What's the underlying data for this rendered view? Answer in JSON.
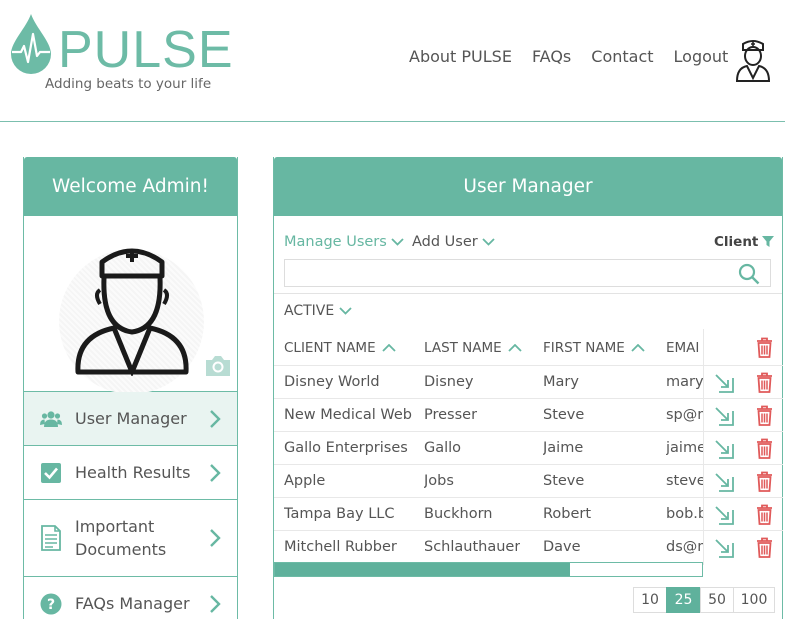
{
  "brand": {
    "name": "PULSE",
    "tagline": "Adding beats to your life",
    "accent": "#67b7a2"
  },
  "nav": [
    {
      "label": "About PULSE"
    },
    {
      "label": "FAQs"
    },
    {
      "label": "Contact"
    },
    {
      "label": "Logout"
    }
  ],
  "left": {
    "title": "Welcome Admin!",
    "menu": [
      {
        "label": "User Manager",
        "icon": "users-icon"
      },
      {
        "label": "Health Results",
        "icon": "checkbox-icon"
      },
      {
        "label": "Important Documents",
        "icon": "document-icon"
      },
      {
        "label": "FAQs Manager",
        "icon": "question-icon"
      }
    ]
  },
  "main": {
    "title": "User Manager",
    "manage_users": "Manage Users",
    "add_user": "Add User",
    "filter_label": "Client",
    "search_placeholder": "",
    "status_filter": "ACTIVE",
    "columns": [
      "CLIENT NAME",
      "LAST NAME",
      "FIRST NAME",
      "EMAI"
    ],
    "rows": [
      [
        "Disney World",
        "Disney",
        "Mary",
        "mary@"
      ],
      [
        "New Medical Web",
        "Presser",
        "Steve",
        "sp@m"
      ],
      [
        "Gallo Enterprises",
        "Gallo",
        "Jaime",
        "jaime"
      ],
      [
        "Apple",
        "Jobs",
        "Steve",
        "steve_"
      ],
      [
        "Tampa Bay LLC",
        "Buckhorn",
        "Robert",
        "bob.b"
      ],
      [
        "Mitchell Rubber",
        "Schlauthauer",
        "Dave",
        "ds@m"
      ]
    ],
    "scroll_position": 0.69,
    "page_sizes": [
      "10",
      "25",
      "50",
      "100"
    ],
    "selected_page_size": "25"
  }
}
